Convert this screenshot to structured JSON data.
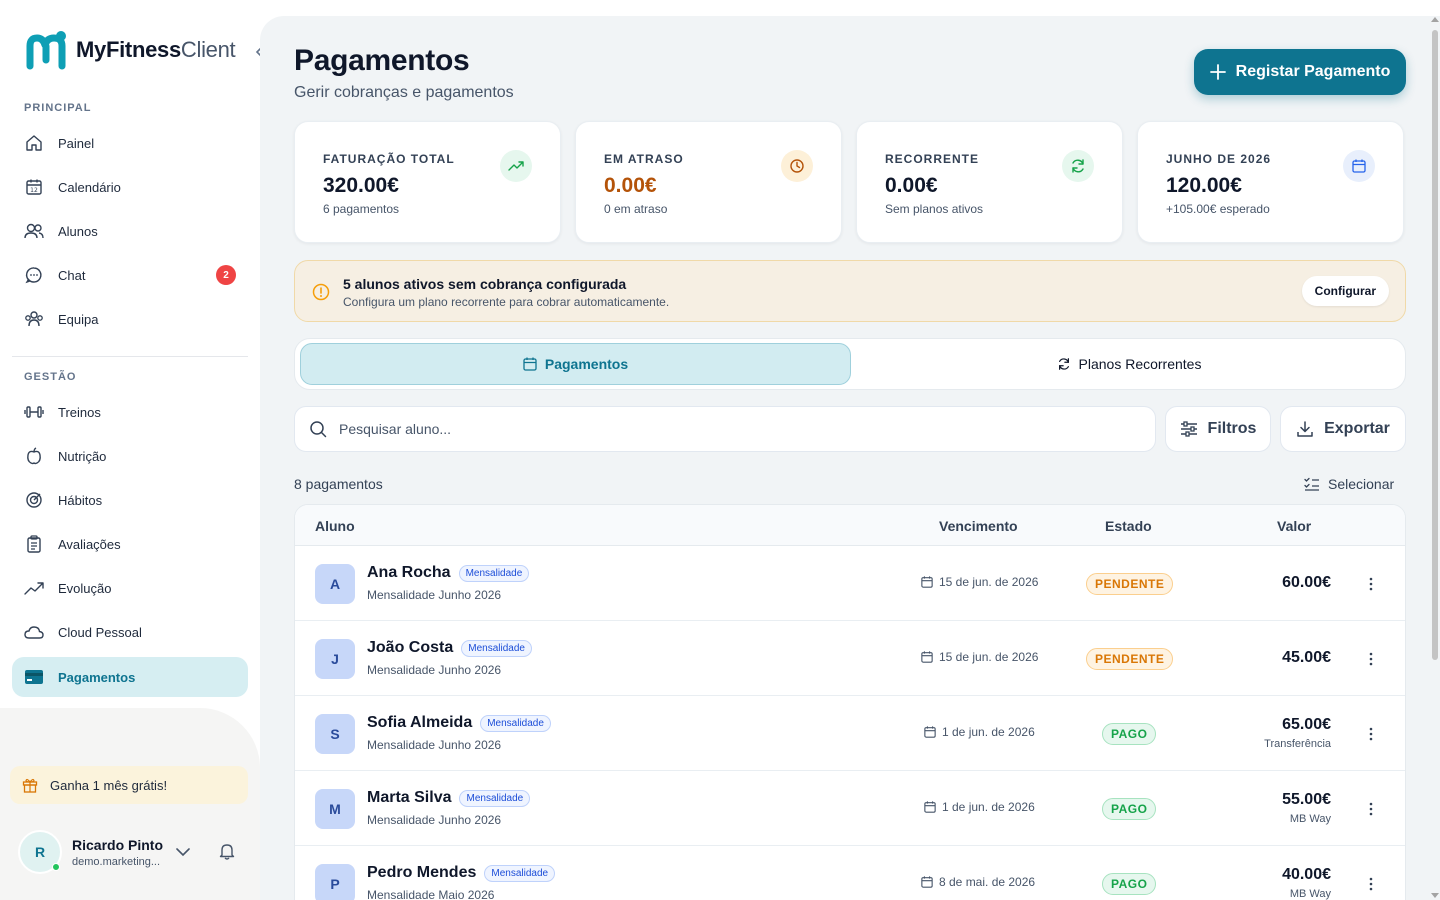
{
  "brand": {
    "name_bold": "MyFitness",
    "name_light": "Client",
    "accent": "#0e7490"
  },
  "sidebar": {
    "sections": {
      "main": "PRINCIPAL",
      "management": "GESTÃO"
    },
    "items": [
      {
        "label": "Painel",
        "icon": "home-icon"
      },
      {
        "label": "Calendário",
        "icon": "calendar-icon"
      },
      {
        "label": "Alunos",
        "icon": "users-icon"
      },
      {
        "label": "Chat",
        "icon": "chat-icon",
        "badge": "2"
      },
      {
        "label": "Equipa",
        "icon": "team-icon"
      },
      {
        "label": "Treinos",
        "icon": "dumbbell-icon"
      },
      {
        "label": "Nutrição",
        "icon": "apple-icon"
      },
      {
        "label": "Hábitos",
        "icon": "target-icon"
      },
      {
        "label": "Avaliações",
        "icon": "clipboard-icon"
      },
      {
        "label": "Evolução",
        "icon": "trend-icon"
      },
      {
        "label": "Cloud Pessoal",
        "icon": "cloud-icon"
      },
      {
        "label": "Pagamentos",
        "icon": "card-icon",
        "active": true
      }
    ],
    "promo": "Ganha 1 mês grátis!",
    "user": {
      "initial": "R",
      "name": "Ricardo Pinto",
      "email": "demo.marketing..."
    }
  },
  "header": {
    "title": "Pagamentos",
    "subtitle": "Gerir cobranças e pagamentos",
    "primary_action": "Registar Pagamento"
  },
  "stats": [
    {
      "label": "FATURAÇÃO TOTAL",
      "value": "320.00€",
      "hint": "6 pagamentos",
      "icon": "trending-up-icon",
      "color": "#16a34a"
    },
    {
      "label": "EM ATRASO",
      "value": "0.00€",
      "hint": "0 em atraso",
      "icon": "clock-icon",
      "color": "#b45309"
    },
    {
      "label": "RECORRENTE",
      "value": "0.00€",
      "hint": "Sem planos ativos",
      "icon": "refresh-icon",
      "color": "#16a34a"
    },
    {
      "label": "JUNHO DE 2026",
      "value": "120.00€",
      "hint": "+105.00€ esperado",
      "icon": "calendar-icon",
      "color": "#2563eb"
    }
  ],
  "alert": {
    "title": "5 alunos ativos sem cobrança configurada",
    "text": "Configura um plano recorrente para cobrar automaticamente.",
    "action": "Configurar"
  },
  "tabs": [
    {
      "label": "Pagamentos",
      "active": true
    },
    {
      "label": "Planos Recorrentes",
      "active": false
    }
  ],
  "toolbar": {
    "search_placeholder": "Pesquisar aluno...",
    "filters": "Filtros",
    "export": "Exportar",
    "count": "8 pagamentos",
    "select": "Selecionar"
  },
  "table": {
    "columns": {
      "student": "Aluno",
      "due": "Vencimento",
      "status": "Estado",
      "value": "Valor"
    },
    "rows": [
      {
        "initial": "A",
        "name": "Ana Rocha",
        "tag": "Mensalidade",
        "desc": "Mensalidade Junho 2026",
        "date": "15 de jun. de 2026",
        "status": "PENDENTE",
        "status_kind": "pending",
        "value": "60.00€",
        "method": ""
      },
      {
        "initial": "J",
        "name": "João Costa",
        "tag": "Mensalidade",
        "desc": "Mensalidade Junho 2026",
        "date": "15 de jun. de 2026",
        "status": "PENDENTE",
        "status_kind": "pending",
        "value": "45.00€",
        "method": ""
      },
      {
        "initial": "S",
        "name": "Sofia Almeida",
        "tag": "Mensalidade",
        "desc": "Mensalidade Junho 2026",
        "date": "1 de jun. de 2026",
        "status": "PAGO",
        "status_kind": "paid",
        "value": "65.00€",
        "method": "Transferência"
      },
      {
        "initial": "M",
        "name": "Marta Silva",
        "tag": "Mensalidade",
        "desc": "Mensalidade Junho 2026",
        "date": "1 de jun. de 2026",
        "status": "PAGO",
        "status_kind": "paid",
        "value": "55.00€",
        "method": "MB Way"
      },
      {
        "initial": "P",
        "name": "Pedro Mendes",
        "tag": "Mensalidade",
        "desc": "Mensalidade Maio 2026",
        "date": "8 de mai. de 2026",
        "status": "PAGO",
        "status_kind": "paid",
        "value": "40.00€",
        "method": "MB Way"
      }
    ]
  }
}
